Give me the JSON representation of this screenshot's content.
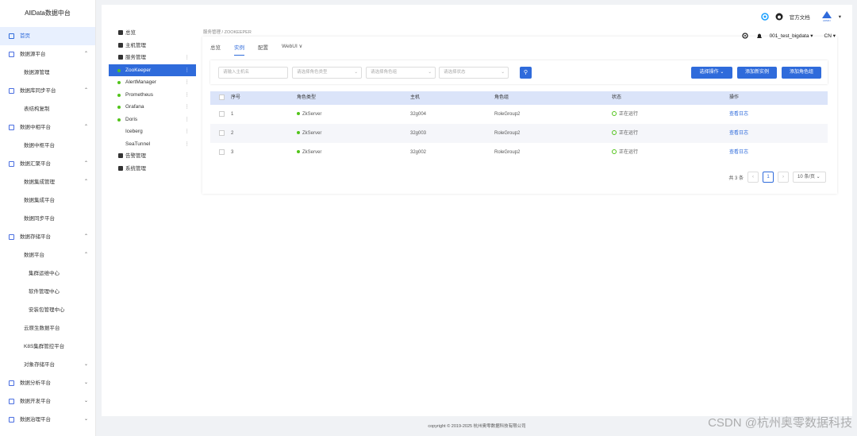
{
  "brand": "AllData数据中台",
  "sidebar": [
    {
      "label": "首页",
      "active": true,
      "chev": ""
    },
    {
      "label": "数据源平台",
      "chev": "^"
    },
    {
      "label": "数据源管理",
      "sub": true,
      "chev": ""
    },
    {
      "label": "数据库同步平台",
      "chev": "^"
    },
    {
      "label": "表结构复制",
      "sub": true,
      "chev": ""
    },
    {
      "label": "数据中相平台",
      "chev": "^"
    },
    {
      "label": "数据中枢平台",
      "sub": true,
      "chev": ""
    },
    {
      "label": "数据汇聚平台",
      "chev": "^"
    },
    {
      "label": "数据集成管理",
      "sub": true,
      "chev": "^"
    },
    {
      "label": "数据集成平台",
      "sub": true,
      "chev": ""
    },
    {
      "label": "数据同步平台",
      "sub": true,
      "chev": ""
    },
    {
      "label": "数据存储平台",
      "chev": "^"
    },
    {
      "label": "数据平台",
      "sub": true,
      "chev": "^"
    },
    {
      "label": "集群运维中心",
      "sub2": true,
      "chev": ""
    },
    {
      "label": "软件管理中心",
      "sub2": true,
      "chev": ""
    },
    {
      "label": "安装包管理中心",
      "sub2": true,
      "chev": ""
    },
    {
      "label": "云原生数据平台",
      "sub": true,
      "chev": ""
    },
    {
      "label": "K8S集群管控平台",
      "sub": true,
      "chev": ""
    },
    {
      "label": "对象存储平台",
      "sub": true,
      "chev": "v"
    },
    {
      "label": "数据分析平台",
      "chev": "v"
    },
    {
      "label": "数据开发平台",
      "chev": "v"
    },
    {
      "label": "数据治理平台",
      "chev": "v"
    }
  ],
  "topbar": {
    "docs": "官方文档",
    "user": "ADMIN"
  },
  "tree": [
    {
      "label": "总览",
      "type": "icon"
    },
    {
      "label": "主机管理",
      "type": "icon"
    },
    {
      "label": "服务管理",
      "type": "icon",
      "more": "⋮"
    },
    {
      "label": "ZooKeeper",
      "type": "dot",
      "active": true,
      "more": "⋮"
    },
    {
      "label": "AlertManager",
      "type": "dot",
      "more": "⋮"
    },
    {
      "label": "Prometheus",
      "type": "dot",
      "more": "⋮"
    },
    {
      "label": "Grafana",
      "type": "dot",
      "more": "⋮"
    },
    {
      "label": "Doris",
      "type": "dot",
      "more": "⋮"
    },
    {
      "label": "Iceberg",
      "type": "none",
      "more": "⋮"
    },
    {
      "label": "SeaTunnel",
      "type": "none",
      "more": "⋮"
    },
    {
      "label": "告警管理",
      "type": "icon"
    },
    {
      "label": "系统管理",
      "type": "icon"
    }
  ],
  "breadcrumb": "服务管理 / ZOOKEEPER",
  "cluster": "001_test_bigdata",
  "lang": "CN",
  "tabs": [
    "总览",
    "实例",
    "配置",
    "WebUI"
  ],
  "filters": {
    "host": "请输入主机名",
    "role_type": "请选择角色类型",
    "role_group": "请选择角色组",
    "status": "请选择状态"
  },
  "buttons": {
    "select_op": "选择操作",
    "add_instance": "添加新实例",
    "add_group": "添加角色组"
  },
  "columns": [
    "序号",
    "角色类型",
    "主机",
    "角色组",
    "状态",
    "操作"
  ],
  "rows": [
    {
      "no": "1",
      "role": "ZkServer",
      "host": "32g004",
      "group": "RoleGroup2",
      "status": "正在运行",
      "action": "查看日志"
    },
    {
      "no": "2",
      "role": "ZkServer",
      "host": "32g003",
      "group": "RoleGroup2",
      "status": "正在运行",
      "action": "查看日志"
    },
    {
      "no": "3",
      "role": "ZkServer",
      "host": "32g002",
      "group": "RoleGroup2",
      "status": "正在运行",
      "action": "查看日志"
    }
  ],
  "pager": {
    "total": "共 3 条",
    "page": "1",
    "size": "10 条/页"
  },
  "footer": "copyright © 2019-2025 杭州奥零数据科技有限公司",
  "watermark": "CSDN @杭州奥零数据科技"
}
